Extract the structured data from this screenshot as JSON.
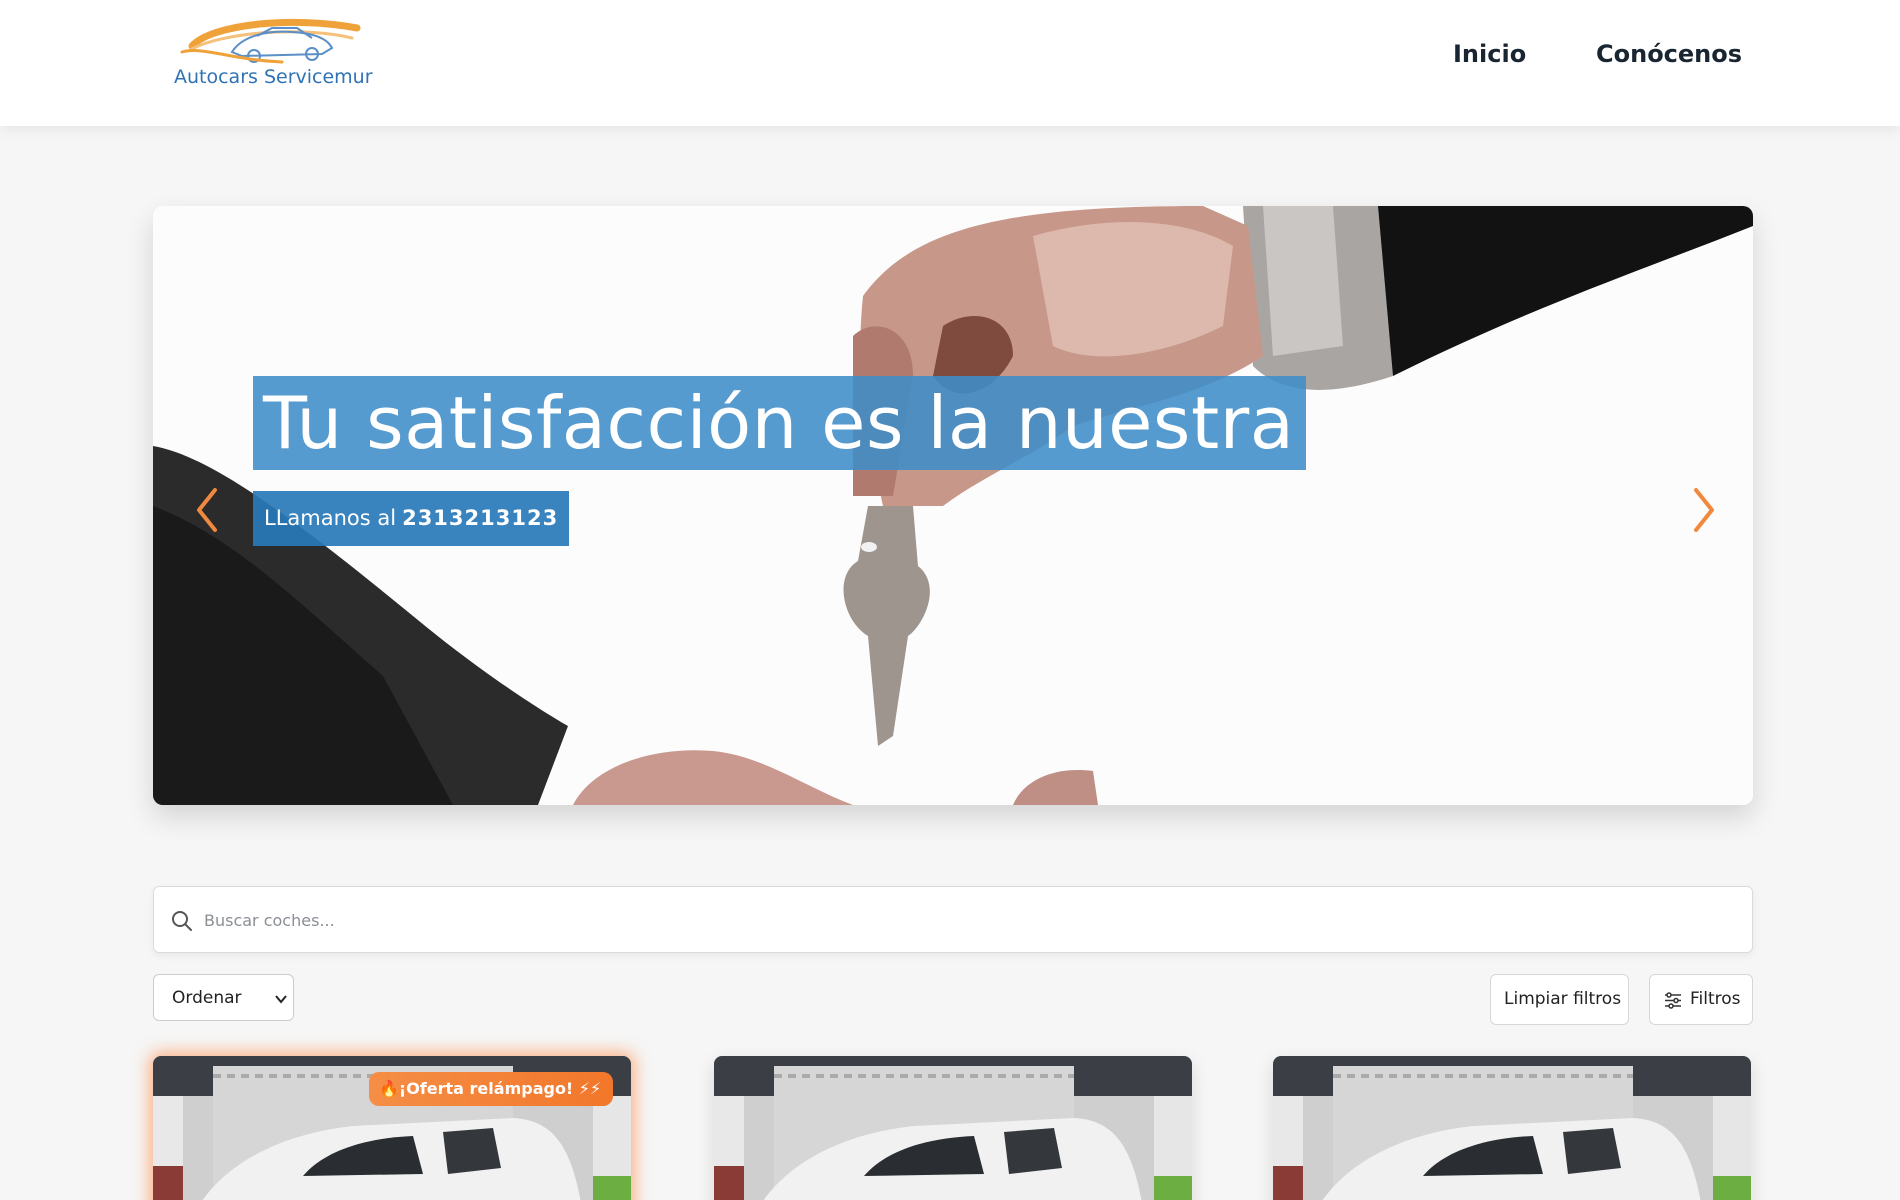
{
  "brand": {
    "name": "Autocars Servicemur"
  },
  "nav": {
    "items": [
      {
        "label": "Inicio"
      },
      {
        "label": "Conócenos"
      }
    ]
  },
  "hero": {
    "title": "Tu satisfacción es la nuestra",
    "subtitle_prefix": "LLamanos al",
    "phone": "2313213123"
  },
  "search": {
    "placeholder": "Buscar coches..."
  },
  "controls": {
    "sort_label": "Ordenar",
    "clear_label": "Limpiar filtros",
    "filters_label": "Filtros"
  },
  "cards": [
    {
      "badge": "🔥¡Oferta relámpago! ⚡⚡"
    }
  ],
  "colors": {
    "accent": "#f0883e",
    "hero_overlay": "#3f8dc8",
    "text": "#1f2a37",
    "background": "#f6f6f6"
  }
}
